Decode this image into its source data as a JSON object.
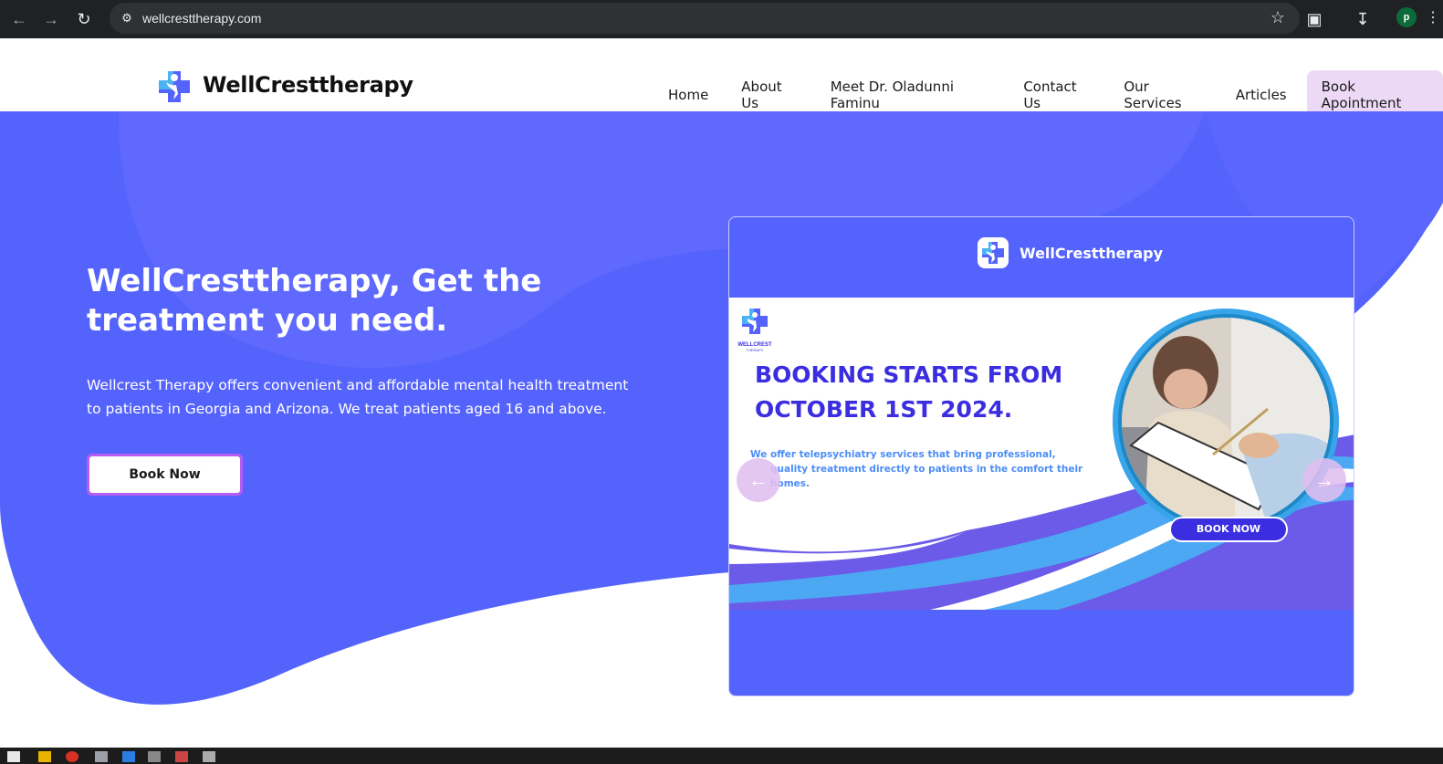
{
  "browser": {
    "url": "wellcresttherapy.com",
    "back_icon": "arrow-left-icon",
    "forward_icon": "arrow-right-icon",
    "reload_icon": "reload-icon",
    "profile_initial": "p"
  },
  "header": {
    "brand_name": "WellCresttherapy",
    "nav": [
      "Home",
      "About Us",
      "Meet Dr. Oladunni Faminu",
      "Contact Us",
      "Our Services",
      "Articles"
    ],
    "cta": "Book Apointment"
  },
  "hero": {
    "title": "WellCresttherapy, Get the treatment you need.",
    "text": "Wellcrest Therapy offers convenient and affordable mental health treatment to patients in Georgia and Arizona. We treat patients aged 16 and above.",
    "button": "Book Now"
  },
  "slider": {
    "brand_name": "WellCresttherapy",
    "slide": {
      "logo_text": "WELLCREST",
      "logo_subtext": "THERAPY",
      "headline": "BOOKING STARTS FROM OCTOBER 1ST 2024.",
      "subtext_line1": "We offer telepsychiatry services that bring professional,",
      "subtext_line2": "quality treatment directly to patients in the comfort their homes.",
      "book_button": "BOOK NOW"
    }
  },
  "colors": {
    "primary": "#5563fd",
    "headline": "#3b2ee0",
    "cta_bg": "#ecd9f5",
    "button_border": "#b65cf0"
  }
}
